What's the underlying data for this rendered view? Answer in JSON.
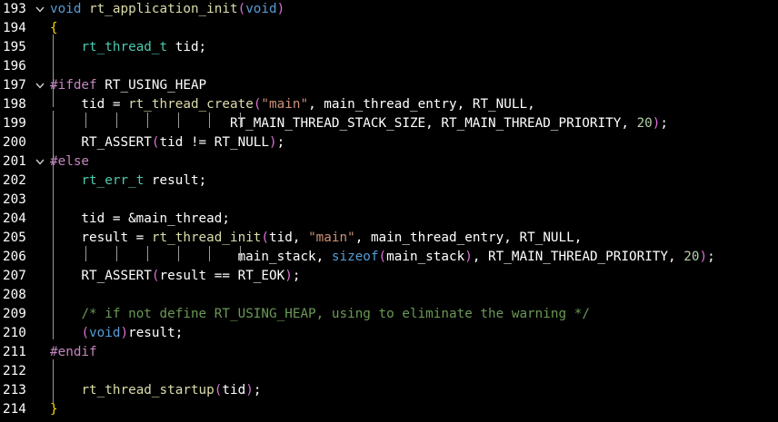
{
  "editor": {
    "lines": [
      {
        "num": "193",
        "fold": true,
        "tokens": [
          {
            "t": "void",
            "c": "kw"
          },
          {
            "t": " ",
            "c": "tx"
          },
          {
            "t": "rt_application_init",
            "c": "fn"
          },
          {
            "t": "(",
            "c": "pn"
          },
          {
            "t": "void",
            "c": "kw"
          },
          {
            "t": ")",
            "c": "pn"
          }
        ]
      },
      {
        "num": "194",
        "fold": false,
        "tokens": [
          {
            "t": "{",
            "c": "br"
          }
        ]
      },
      {
        "num": "195",
        "fold": false,
        "tokens": [
          {
            "t": "    ",
            "c": "tx"
          },
          {
            "t": "rt_thread_t",
            "c": "ty"
          },
          {
            "t": " tid;",
            "c": "tx"
          }
        ]
      },
      {
        "num": "196",
        "fold": false,
        "tokens": []
      },
      {
        "num": "197",
        "fold": true,
        "tokens": [
          {
            "t": "#ifdef",
            "c": "pp"
          },
          {
            "t": " RT_USING_HEAP",
            "c": "tx"
          }
        ]
      },
      {
        "num": "198",
        "fold": false,
        "tokens": [
          {
            "t": "    tid = ",
            "c": "tx"
          },
          {
            "t": "rt_thread_create",
            "c": "fn"
          },
          {
            "t": "(",
            "c": "pn"
          },
          {
            "t": "\"main\"",
            "c": "str"
          },
          {
            "t": ", main_thread_entry, RT_NULL,",
            "c": "tx"
          }
        ]
      },
      {
        "num": "199",
        "fold": false,
        "tokens": [
          {
            "t": "                       RT_MAIN_THREAD_STACK_SIZE, RT_MAIN_THREAD_PRIORITY, ",
            "c": "tx"
          },
          {
            "t": "20",
            "c": "num"
          },
          {
            "t": ")",
            "c": "pn"
          },
          {
            "t": ";",
            "c": "tx"
          }
        ]
      },
      {
        "num": "200",
        "fold": false,
        "tokens": [
          {
            "t": "    RT_ASSERT",
            "c": "tx"
          },
          {
            "t": "(",
            "c": "pn"
          },
          {
            "t": "tid != RT_NULL",
            "c": "tx"
          },
          {
            "t": ")",
            "c": "pn"
          },
          {
            "t": ";",
            "c": "tx"
          }
        ]
      },
      {
        "num": "201",
        "fold": true,
        "tokens": [
          {
            "t": "#else",
            "c": "pp"
          }
        ]
      },
      {
        "num": "202",
        "fold": false,
        "tokens": [
          {
            "t": "    ",
            "c": "tx"
          },
          {
            "t": "rt_err_t",
            "c": "ty"
          },
          {
            "t": " result;",
            "c": "tx"
          }
        ]
      },
      {
        "num": "203",
        "fold": false,
        "tokens": []
      },
      {
        "num": "204",
        "fold": false,
        "tokens": [
          {
            "t": "    tid = &main_thread;",
            "c": "tx"
          }
        ]
      },
      {
        "num": "205",
        "fold": false,
        "tokens": [
          {
            "t": "    result = ",
            "c": "tx"
          },
          {
            "t": "rt_thread_init",
            "c": "fn"
          },
          {
            "t": "(",
            "c": "pn"
          },
          {
            "t": "tid, ",
            "c": "tx"
          },
          {
            "t": "\"main\"",
            "c": "str"
          },
          {
            "t": ", main_thread_entry, RT_NULL,",
            "c": "tx"
          }
        ]
      },
      {
        "num": "206",
        "fold": false,
        "tokens": [
          {
            "t": "                        main_stack, ",
            "c": "tx"
          },
          {
            "t": "sizeof",
            "c": "kw"
          },
          {
            "t": "(",
            "c": "pn"
          },
          {
            "t": "main_stack",
            "c": "tx"
          },
          {
            "t": ")",
            "c": "pn"
          },
          {
            "t": ", RT_MAIN_THREAD_PRIORITY, ",
            "c": "tx"
          },
          {
            "t": "20",
            "c": "num"
          },
          {
            "t": ")",
            "c": "pn"
          },
          {
            "t": ";",
            "c": "tx"
          }
        ]
      },
      {
        "num": "207",
        "fold": false,
        "tokens": [
          {
            "t": "    RT_ASSERT",
            "c": "tx"
          },
          {
            "t": "(",
            "c": "pn"
          },
          {
            "t": "result == RT_EOK",
            "c": "tx"
          },
          {
            "t": ")",
            "c": "pn"
          },
          {
            "t": ";",
            "c": "tx"
          }
        ]
      },
      {
        "num": "208",
        "fold": false,
        "tokens": []
      },
      {
        "num": "209",
        "fold": false,
        "tokens": [
          {
            "t": "    ",
            "c": "tx"
          },
          {
            "t": "/* if not define RT_USING_HEAP, using to eliminate the warning */",
            "c": "cm"
          }
        ]
      },
      {
        "num": "210",
        "fold": false,
        "tokens": [
          {
            "t": "    ",
            "c": "tx"
          },
          {
            "t": "(",
            "c": "pn"
          },
          {
            "t": "void",
            "c": "kw"
          },
          {
            "t": ")",
            "c": "pn"
          },
          {
            "t": "result;",
            "c": "tx"
          }
        ]
      },
      {
        "num": "211",
        "fold": false,
        "tokens": [
          {
            "t": "#endif",
            "c": "pp"
          }
        ]
      },
      {
        "num": "212",
        "fold": false,
        "tokens": []
      },
      {
        "num": "213",
        "fold": false,
        "tokens": [
          {
            "t": "    ",
            "c": "tx"
          },
          {
            "t": "rt_thread_startup",
            "c": "fn"
          },
          {
            "t": "(",
            "c": "pn"
          },
          {
            "t": "tid",
            "c": "tx"
          },
          {
            "t": ")",
            "c": "pn"
          },
          {
            "t": ";",
            "c": "tx"
          }
        ]
      },
      {
        "num": "214",
        "fold": false,
        "tokens": [
          {
            "t": "}",
            "c": "br"
          }
        ]
      }
    ],
    "fold_icon": "chevron-down-icon",
    "colors": {
      "background": "#000000",
      "keyword": "#569cd6",
      "function": "#dcdcaa",
      "type": "#4ec9b0",
      "string": "#ce9178",
      "number": "#b5cea8",
      "comment": "#6a9955",
      "preprocessor": "#c586c0",
      "brace": "#ffd700",
      "paren": "#da70d6"
    }
  }
}
